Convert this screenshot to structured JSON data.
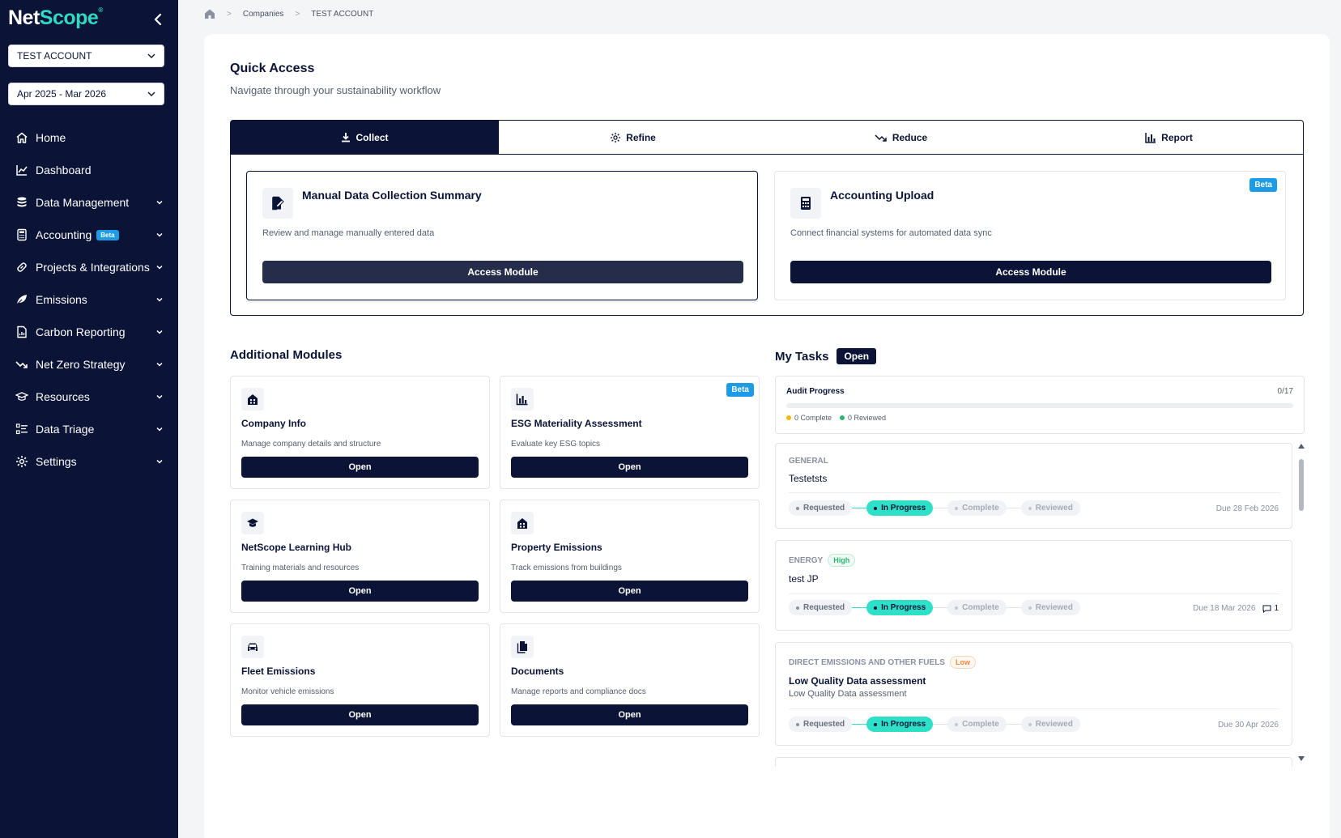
{
  "brand": {
    "part1": "Net",
    "part2": "Scope",
    "mark": "®"
  },
  "account_select": {
    "value": "TEST ACCOUNT"
  },
  "period_select": {
    "value": "Apr 2025 - Mar 2026"
  },
  "nav": [
    {
      "label": "Home",
      "icon": "home-icon",
      "chevron": false
    },
    {
      "label": "Dashboard",
      "icon": "line-chart-icon",
      "chevron": false
    },
    {
      "label": "Data Management",
      "icon": "database-icon",
      "chevron": true
    },
    {
      "label": "Accounting",
      "icon": "calculator-icon",
      "chevron": true,
      "badge": "Beta"
    },
    {
      "label": "Projects & Integrations",
      "icon": "link-icon",
      "chevron": true
    },
    {
      "label": "Emissions",
      "icon": "leaf-icon",
      "chevron": true
    },
    {
      "label": "Carbon Reporting",
      "icon": "report-file-icon",
      "chevron": true
    },
    {
      "label": "Net Zero Strategy",
      "icon": "trend-down-icon",
      "chevron": true
    },
    {
      "label": "Resources",
      "icon": "graduation-cap-icon",
      "chevron": true
    },
    {
      "label": "Data Triage",
      "icon": "checklist-icon",
      "chevron": true
    },
    {
      "label": "Settings",
      "icon": "gear-icon",
      "chevron": true
    }
  ],
  "breadcrumb": {
    "items": [
      "Companies",
      "TEST ACCOUNT"
    ]
  },
  "quick_access": {
    "title": "Quick Access",
    "subtitle": "Navigate through your sustainability workflow",
    "tabs": [
      "Collect",
      "Refine",
      "Reduce",
      "Report"
    ],
    "active_tab": "Collect",
    "modules": [
      {
        "title": "Manual Data Collection Summary",
        "desc": "Review and manage manually entered data",
        "button": "Access Module"
      },
      {
        "title": "Accounting Upload",
        "desc": "Connect financial systems for automated data sync",
        "button": "Access Module",
        "badge": "Beta"
      }
    ]
  },
  "additional_modules": {
    "title": "Additional Modules",
    "items": [
      {
        "name": "Company Info",
        "desc": "Manage company details and structure",
        "button": "Open",
        "icon": "building-icon"
      },
      {
        "name": "ESG Materiality Assessment",
        "desc": "Evaluate key ESG topics",
        "button": "Open",
        "icon": "bar-chart-icon",
        "badge": "Beta"
      },
      {
        "name": "NetScope Learning Hub",
        "desc": "Training materials and resources",
        "button": "Open",
        "icon": "graduation-cap-icon"
      },
      {
        "name": "Property Emissions",
        "desc": "Track emissions from buildings",
        "button": "Open",
        "icon": "building-icon"
      },
      {
        "name": "Fleet Emissions",
        "desc": "Monitor vehicle emissions",
        "button": "Open",
        "icon": "car-icon"
      },
      {
        "name": "Documents",
        "desc": "Manage reports and compliance docs",
        "button": "Open",
        "icon": "document-icon"
      }
    ]
  },
  "tasks": {
    "title": "My Tasks",
    "filter": "Open",
    "audit": {
      "title": "Audit Progress",
      "count": "0/17",
      "progress": 0,
      "complete": "0 Complete",
      "reviewed": "0 Reviewed"
    },
    "steps": [
      "Requested",
      "In Progress",
      "Complete",
      "Reviewed"
    ],
    "items": [
      {
        "category": "GENERAL",
        "name": "Testetsts",
        "due": "Due 28 Feb 2026",
        "current_step": "In Progress"
      },
      {
        "category": "ENERGY",
        "priority": "High",
        "name": "test JP",
        "due": "Due 18 Mar 2026",
        "comments": "1",
        "current_step": "In Progress"
      },
      {
        "category": "DIRECT EMISSIONS AND OTHER FUELS",
        "priority": "Low",
        "name": "Low Quality Data assessment",
        "desc": "Low Quality Data assessment",
        "due": "Due 30 Apr 2026",
        "current_step": "In Progress"
      }
    ]
  },
  "colors": {
    "navy": "#0b1437",
    "accent": "#2fd9c4",
    "beta": "#1e9be6"
  }
}
